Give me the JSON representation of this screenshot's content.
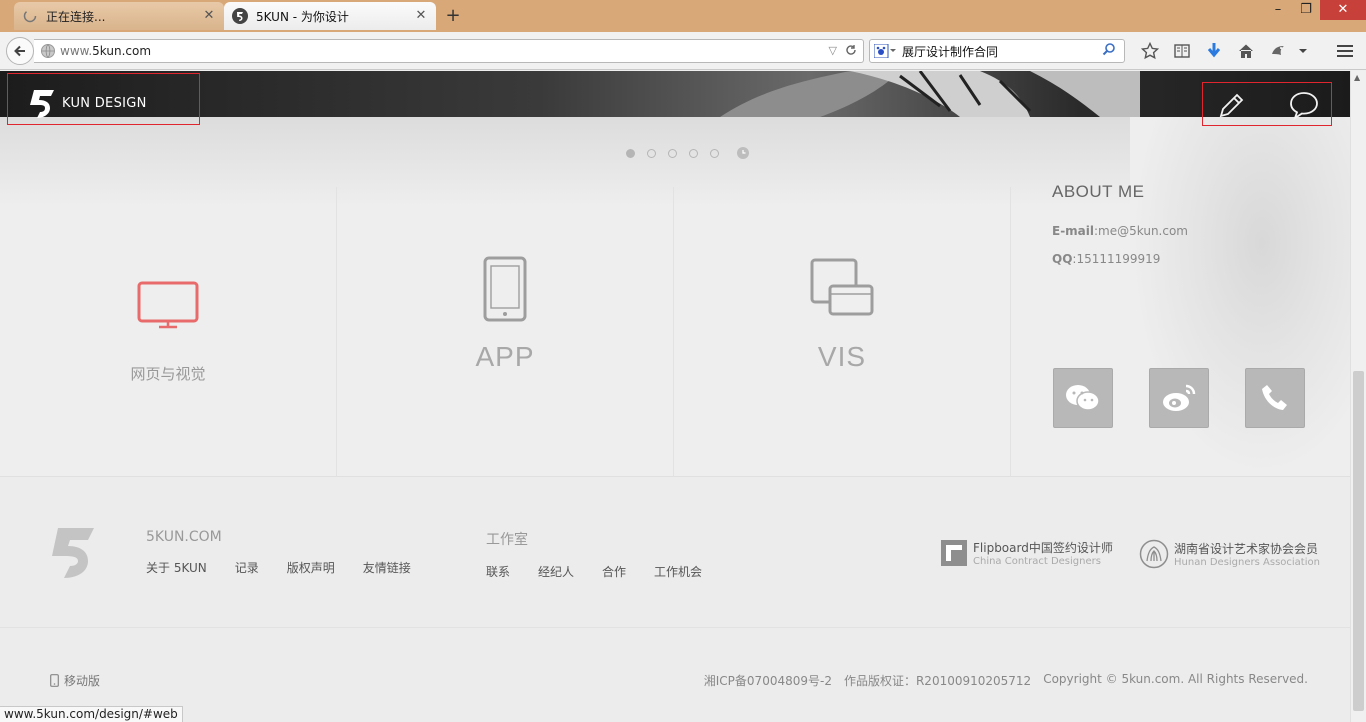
{
  "browser": {
    "tabs": [
      {
        "label": "正在连接...",
        "state": "loading"
      },
      {
        "label": "5KUN - 为你设计",
        "state": "active"
      }
    ],
    "url_prefix": "www.",
    "url_main": "5kun.com",
    "search_value": "展厅设计制作合同",
    "status_url": "www.5kun.com/design/#web"
  },
  "header": {
    "logo_text": "KUN DESIGN",
    "slider_dots": 5,
    "slider_active": 0
  },
  "services": [
    {
      "label": "网页与视觉",
      "icon": "monitor-icon",
      "active": true
    },
    {
      "label": "APP",
      "icon": "phone-icon",
      "active": false
    },
    {
      "label": "VIS",
      "icon": "devices-icon",
      "active": false
    }
  ],
  "about": {
    "title": "ABOUT ME",
    "email_label": "E-mail",
    "email_value": ":me@5kun.com",
    "qq_label": "QQ",
    "qq_value": ":15111199919",
    "social": [
      "wechat-icon",
      "weibo-icon",
      "phone-call-icon"
    ]
  },
  "footer": {
    "col1": {
      "head": "5KUN.COM",
      "links": [
        "关于 5KUN",
        "记录",
        "版权声明",
        "友情链接"
      ]
    },
    "col2": {
      "head": "工作室",
      "links": [
        "联系",
        "经纪人",
        "合作",
        "工作机会"
      ]
    },
    "partners": [
      {
        "title": "Flipboard中国签约设计师",
        "subtitle": "China Contract Designers"
      },
      {
        "title": "湖南省设计艺术家协会会员",
        "subtitle": "Hunan Designers Association"
      }
    ],
    "mobile_label": "移动版",
    "icp": "湘ICP备07004809号-2",
    "copyright_reg": "作品版权证：R20100910205712",
    "copyright": "Copyright © 5kun.com. All Rights Reserved."
  },
  "colors": {
    "accent_red": "#e86a6a",
    "highlight_box": "#e0252e",
    "chrome_titlebar": "#d8a878"
  }
}
